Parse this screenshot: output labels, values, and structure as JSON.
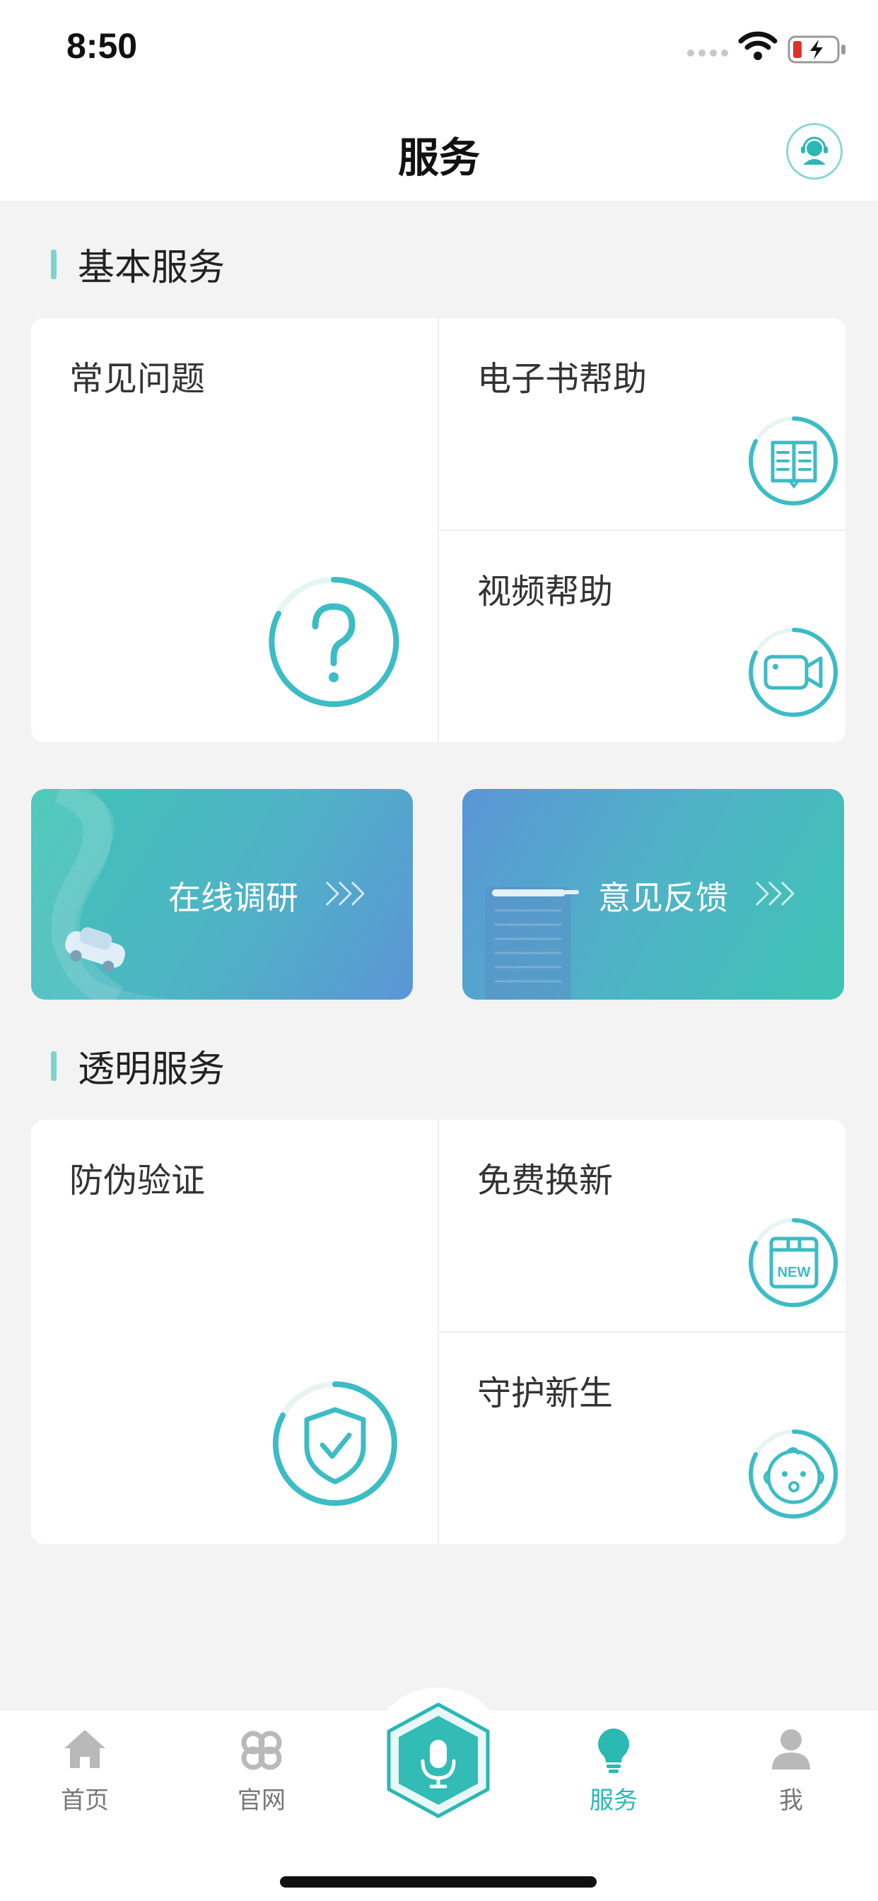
{
  "status": {
    "time": "8:50"
  },
  "header": {
    "title": "服务"
  },
  "basic": {
    "title": "基本服务",
    "faq": "常见问题",
    "ebook": "电子书帮助",
    "video": "视频帮助"
  },
  "banners": {
    "survey": "在线调研",
    "feedback": "意见反馈"
  },
  "transparent": {
    "title": "透明服务",
    "verify": "防伪验证",
    "renew": "免费换新",
    "guard": "守护新生"
  },
  "tabs": [
    {
      "label": "首页",
      "icon": "home-icon"
    },
    {
      "label": "官网",
      "icon": "website-icon"
    },
    {
      "label": "",
      "icon": "microphone-icon"
    },
    {
      "label": "服务",
      "icon": "lightbulb-icon"
    },
    {
      "label": "我",
      "icon": "person-icon"
    }
  ],
  "colors": {
    "accent": "#2ab8b3",
    "teal": "#40c2b8",
    "blue": "#5b95d6"
  }
}
